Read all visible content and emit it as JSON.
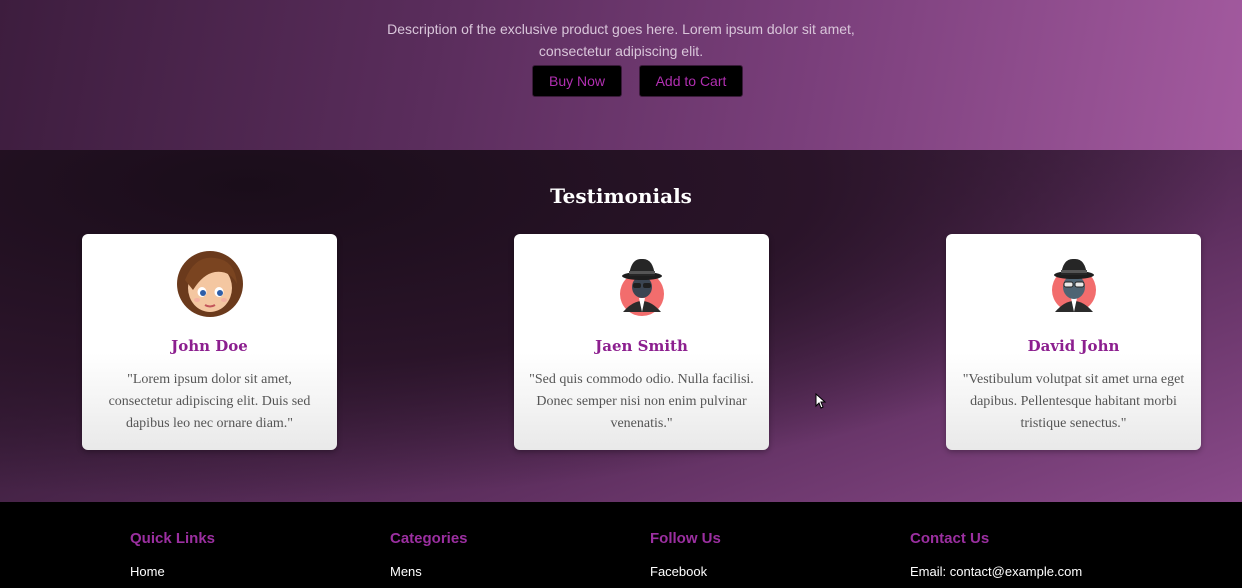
{
  "hero": {
    "description": "Description of the exclusive product goes here. Lorem ipsum dolor sit amet, consectetur adipiscing elit.",
    "buy_label": "Buy Now",
    "cart_label": "Add to Cart"
  },
  "testimonials": {
    "heading": "Testimonials",
    "items": [
      {
        "name": "John Doe",
        "quote": "\"Lorem ipsum dolor sit amet, consectetur adipiscing elit. Duis sed dapibus leo nec ornare diam.\"",
        "avatar": "girl-avatar-icon"
      },
      {
        "name": "Jaen Smith",
        "quote": "\"Sed quis commodo odio. Nulla facilisi. Donec semper nisi non enim pulvinar venenatis.\"",
        "avatar": "spy-avatar-icon"
      },
      {
        "name": "David John",
        "quote": "\"Vestibulum volutpat sit amet urna eget dapibus. Pellentesque habitant morbi tristique senectus.\"",
        "avatar": "spy-avatar-icon"
      }
    ]
  },
  "footer": {
    "quick_links": {
      "heading": "Quick Links",
      "items": [
        "Home"
      ]
    },
    "categories": {
      "heading": "Categories",
      "items": [
        "Mens"
      ]
    },
    "follow_us": {
      "heading": "Follow Us",
      "items": [
        "Facebook"
      ]
    },
    "contact_us": {
      "heading": "Contact Us",
      "items": [
        "Email: contact@example.com"
      ]
    }
  },
  "colors": {
    "accent": "#9b2fa0",
    "name_color": "#8c1f8f",
    "button_text": "#b12fb1"
  }
}
